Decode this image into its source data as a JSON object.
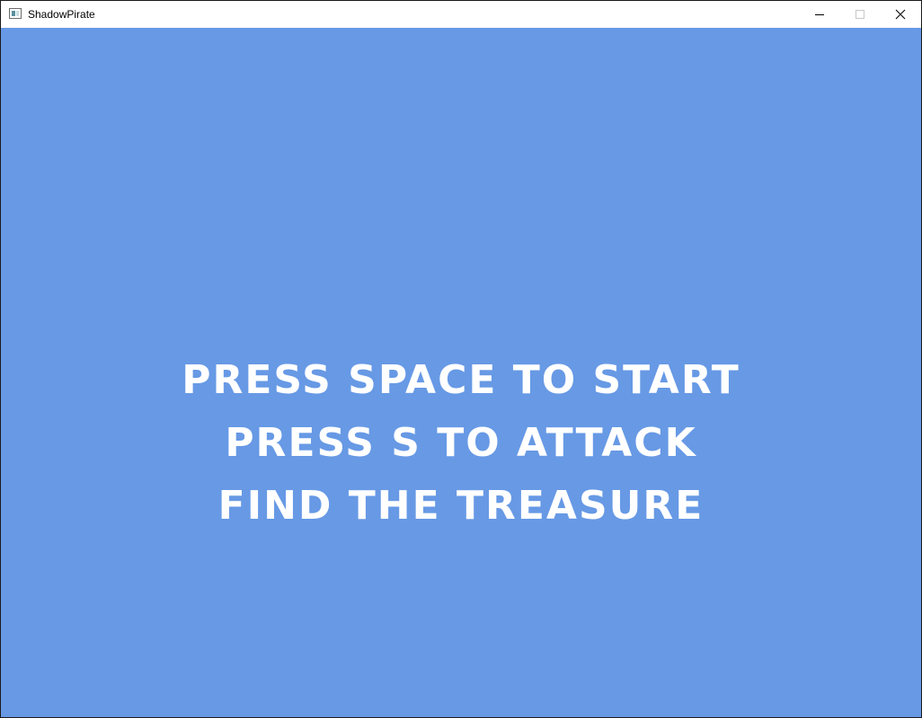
{
  "window": {
    "title": "ShadowPirate",
    "icon": "app-window-icon",
    "buttons": {
      "minimize_icon": "minimize-icon",
      "maximize_icon": "maximize-icon",
      "close_icon": "close-icon"
    }
  },
  "game": {
    "background_color": "#6799e5",
    "text_color": "#ffffff",
    "lines": [
      "PRESS SPACE TO START",
      "PRESS S TO ATTACK",
      "FIND THE TREASURE"
    ]
  }
}
